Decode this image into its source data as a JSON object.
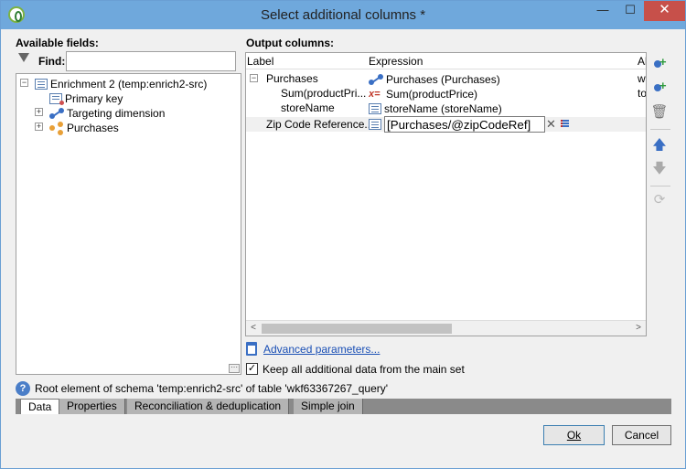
{
  "window": {
    "title": "Select additional columns *",
    "controls": {
      "minimize": "—",
      "maximize": "☐",
      "close": "✕"
    }
  },
  "available_fields": {
    "heading": "Available fields:",
    "find_label": "Find:",
    "find_value": "",
    "tree": [
      {
        "label": "Enrichment 2 (temp:enrich2-src)",
        "icon": "table-icon",
        "expander": "−"
      },
      {
        "label": "Primary key",
        "icon": "key-icon",
        "expander": ""
      },
      {
        "label": "Targeting dimension",
        "icon": "link-icon",
        "expander": "+"
      },
      {
        "label": "Purchases",
        "icon": "share-icon",
        "expander": "+"
      }
    ],
    "grip": "⋯"
  },
  "output_columns": {
    "heading": "Output columns:",
    "headers": {
      "label": "Label",
      "expression": "Expression",
      "alias": "Al"
    },
    "rows": [
      {
        "label": "Purchases",
        "expression": "Purchases (Purchases)",
        "alias": "w",
        "icon": "link-icon",
        "expander": "−"
      },
      {
        "label": "Sum(productPri...",
        "expression": "Sum(productPrice)",
        "alias": "to",
        "icon": "formula-icon",
        "icon_glyph": "x="
      },
      {
        "label": "storeName",
        "expression": "storeName (storeName)",
        "alias": "",
        "icon": "table-icon"
      },
      {
        "label": "Zip Code Reference...",
        "expression": "[Purchases/@zipCodeRef]",
        "alias": "",
        "icon": "table-icon"
      }
    ],
    "scroll": {
      "left": "<",
      "right": ">"
    }
  },
  "tools": {
    "add_above": "add-column-icon",
    "add_below": "add-column-icon",
    "delete": "🗑",
    "move_up": "🡅",
    "move_down": "🡇",
    "refresh": "⟳"
  },
  "advanced_link": "Advanced parameters...",
  "keep_data": {
    "label": "Keep all additional data from the main set",
    "checked": "✓"
  },
  "info": {
    "icon": "?",
    "text": "Root element of schema 'temp:enrich2-src' of table 'wkf63367267_query'"
  },
  "tabs": [
    "Data",
    "Properties",
    "Reconciliation & deduplication",
    "Simple join"
  ],
  "buttons": {
    "ok": "Ok",
    "cancel": "Cancel"
  },
  "colors": {
    "titlebar": "#6fa8dc",
    "close": "#c7504a",
    "link": "#1a4fb5",
    "accent": "#3a6fc4"
  }
}
